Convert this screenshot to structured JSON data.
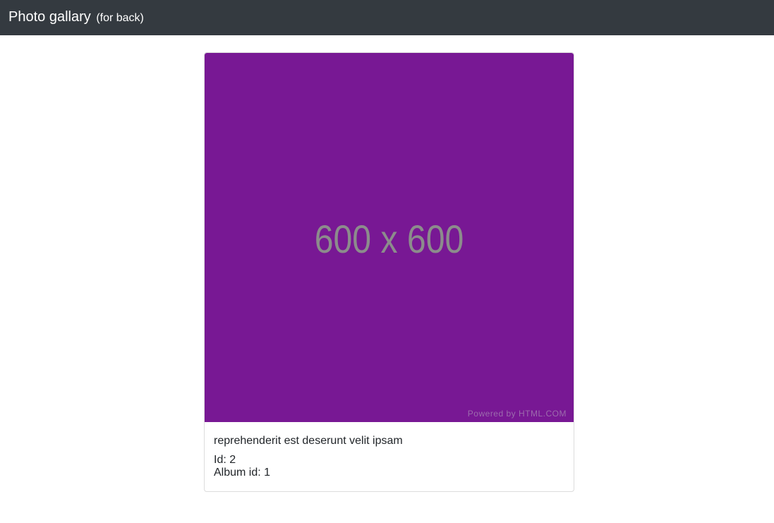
{
  "navbar": {
    "brand_title": "Photo gallary",
    "brand_subtitle": "(for back)",
    "background_color": "#343a40"
  },
  "photo_card": {
    "image": {
      "placeholder_text": "600 x 600",
      "credit_text": "Powered by HTML.COM",
      "background_color": "#781894"
    },
    "title": "reprehenderit est deserunt velit ipsam",
    "id_line": "Id: 2",
    "album_line": "Album id: 1"
  }
}
